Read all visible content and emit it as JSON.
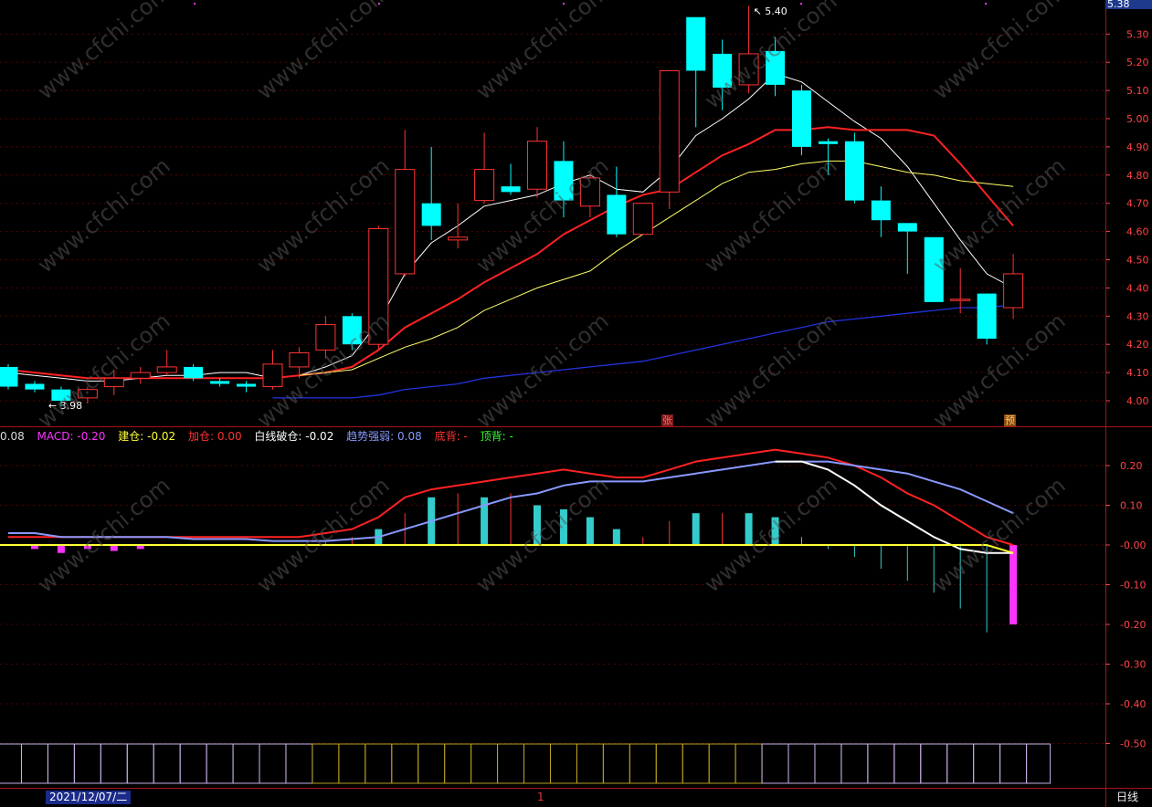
{
  "price_axis_badge": "5.38",
  "period_label": "日线",
  "date_label": "2021/12/07/二",
  "cursor_index_label": "1",
  "tags": [
    {
      "text": "张",
      "bg": "#7a1a1a",
      "fg": "#ff6666"
    },
    {
      "text": "预",
      "bg": "#8a4a10",
      "fg": "#ffcc66"
    }
  ],
  "indicator_header": [
    {
      "key": "prefix",
      "text": "0.08",
      "color": "#dddddd"
    },
    {
      "key": "macd",
      "text": "MACD: -0.20",
      "color": "#ff33ff"
    },
    {
      "key": "jiancang",
      "text": "建仓: -0.02",
      "color": "#ffff33"
    },
    {
      "key": "jiacang",
      "text": "加仓: 0.00",
      "color": "#ff3333"
    },
    {
      "key": "baixian",
      "text": "白线破仓: -0.02",
      "color": "#ffffff"
    },
    {
      "key": "qushi",
      "text": "趋势强弱: 0.08",
      "color": "#8899ff"
    },
    {
      "key": "dibei",
      "text": "底背: -",
      "color": "#ff3333"
    },
    {
      "key": "dingbei",
      "text": "顶背: -",
      "color": "#33ff33"
    }
  ],
  "colors": {
    "up": "#ff3333",
    "down": "#00ffff",
    "ma_white": "#ffffff",
    "ma_red": "#ff2222",
    "ma_yellow": "#ffff66",
    "ma_blue": "#2233dd",
    "grid": "#5a0000",
    "axis_text": "#ff4444",
    "macd_down": "#ff33ff"
  },
  "chart_data": [
    {
      "type": "candlestick",
      "title": "",
      "ylim": [
        3.95,
        5.4
      ],
      "price_ticks": [
        5.3,
        5.2,
        5.1,
        5.0,
        4.9,
        4.8,
        4.7,
        4.6,
        4.5,
        4.4,
        4.3,
        4.2,
        4.1,
        4.0
      ],
      "price_tick_labels": [
        "5.30",
        "5.20",
        "5.10",
        "5.00",
        "4.90",
        "4.80",
        "4.70",
        "4.60",
        "4.50",
        "4.40",
        "4.30",
        "4.20",
        "4.10",
        "4.00"
      ],
      "annotations": [
        {
          "text": "5.40",
          "index": 28
        },
        {
          "text": "3.98",
          "index": 2
        }
      ],
      "candles": [
        {
          "o": 4.12,
          "h": 4.13,
          "l": 4.04,
          "c": 4.05
        },
        {
          "o": 4.06,
          "h": 4.07,
          "l": 4.03,
          "c": 4.04
        },
        {
          "o": 4.04,
          "h": 4.05,
          "l": 3.98,
          "c": 4.0
        },
        {
          "o": 4.01,
          "h": 4.05,
          "l": 3.99,
          "c": 4.04
        },
        {
          "o": 4.05,
          "h": 4.11,
          "l": 4.02,
          "c": 4.08
        },
        {
          "o": 4.08,
          "h": 4.12,
          "l": 4.06,
          "c": 4.1
        },
        {
          "o": 4.1,
          "h": 4.18,
          "l": 4.09,
          "c": 4.12
        },
        {
          "o": 4.12,
          "h": 4.13,
          "l": 4.07,
          "c": 4.08
        },
        {
          "o": 4.07,
          "h": 4.08,
          "l": 4.05,
          "c": 4.06
        },
        {
          "o": 4.06,
          "h": 4.07,
          "l": 4.03,
          "c": 4.05
        },
        {
          "o": 4.05,
          "h": 4.18,
          "l": 4.04,
          "c": 4.13
        },
        {
          "o": 4.12,
          "h": 4.19,
          "l": 4.08,
          "c": 4.17
        },
        {
          "o": 4.18,
          "h": 4.3,
          "l": 4.15,
          "c": 4.27
        },
        {
          "o": 4.3,
          "h": 4.31,
          "l": 4.18,
          "c": 4.2
        },
        {
          "o": 4.2,
          "h": 4.62,
          "l": 4.18,
          "c": 4.61
        },
        {
          "o": 4.45,
          "h": 4.96,
          "l": 4.44,
          "c": 4.82
        },
        {
          "o": 4.7,
          "h": 4.9,
          "l": 4.57,
          "c": 4.62
        },
        {
          "o": 4.57,
          "h": 4.7,
          "l": 4.54,
          "c": 4.58
        },
        {
          "o": 4.71,
          "h": 4.95,
          "l": 4.7,
          "c": 4.82
        },
        {
          "o": 4.76,
          "h": 4.84,
          "l": 4.73,
          "c": 4.74
        },
        {
          "o": 4.75,
          "h": 4.97,
          "l": 4.72,
          "c": 4.92
        },
        {
          "o": 4.85,
          "h": 4.92,
          "l": 4.65,
          "c": 4.71
        },
        {
          "o": 4.69,
          "h": 4.8,
          "l": 4.65,
          "c": 4.79
        },
        {
          "o": 4.73,
          "h": 4.83,
          "l": 4.58,
          "c": 4.59
        },
        {
          "o": 4.59,
          "h": 4.7,
          "l": 4.59,
          "c": 4.7
        },
        {
          "o": 4.74,
          "h": 5.17,
          "l": 4.68,
          "c": 5.17
        },
        {
          "o": 5.36,
          "h": 5.36,
          "l": 4.97,
          "c": 5.17
        },
        {
          "o": 5.23,
          "h": 5.28,
          "l": 5.03,
          "c": 5.11
        },
        {
          "o": 5.12,
          "h": 5.4,
          "l": 5.09,
          "c": 5.23
        },
        {
          "o": 5.24,
          "h": 5.29,
          "l": 5.08,
          "c": 5.12
        },
        {
          "o": 5.1,
          "h": 5.12,
          "l": 4.87,
          "c": 4.9
        },
        {
          "o": 4.92,
          "h": 4.93,
          "l": 4.8,
          "c": 4.91
        },
        {
          "o": 4.92,
          "h": 4.95,
          "l": 4.7,
          "c": 4.71
        },
        {
          "o": 4.71,
          "h": 4.76,
          "l": 4.58,
          "c": 4.64
        },
        {
          "o": 4.63,
          "h": 4.63,
          "l": 4.45,
          "c": 4.6
        },
        {
          "o": 4.58,
          "h": 4.58,
          "l": 4.35,
          "c": 4.35
        },
        {
          "o": 4.36,
          "h": 4.47,
          "l": 4.31,
          "c": 4.36
        },
        {
          "o": 4.38,
          "h": 4.38,
          "l": 4.2,
          "c": 4.22
        },
        {
          "o": 4.33,
          "h": 4.52,
          "l": 4.29,
          "c": 4.45
        }
      ],
      "moving_averages": {
        "white": [
          4.1,
          4.09,
          4.08,
          4.07,
          4.07,
          4.08,
          4.09,
          4.09,
          4.1,
          4.1,
          4.08,
          4.09,
          4.12,
          4.16,
          4.28,
          4.45,
          4.56,
          4.62,
          4.69,
          4.71,
          4.73,
          4.77,
          4.8,
          4.75,
          4.74,
          4.82,
          4.94,
          5.0,
          5.07,
          5.16,
          5.13,
          5.06,
          4.99,
          4.93,
          4.83,
          4.7,
          4.57,
          4.45,
          4.4
        ],
        "red": [
          4.11,
          4.1,
          4.09,
          4.08,
          4.08,
          4.08,
          4.08,
          4.08,
          4.08,
          4.08,
          4.08,
          4.09,
          4.1,
          4.12,
          4.18,
          4.26,
          4.31,
          4.36,
          4.42,
          4.47,
          4.52,
          4.59,
          4.64,
          4.69,
          4.73,
          4.75,
          4.81,
          4.87,
          4.91,
          4.96,
          4.96,
          4.97,
          4.96,
          4.96,
          4.96,
          4.94,
          4.84,
          4.73,
          4.62
        ],
        "yellow": [
          null,
          null,
          null,
          null,
          null,
          null,
          null,
          null,
          null,
          null,
          null,
          4.09,
          4.1,
          4.11,
          4.15,
          4.19,
          4.22,
          4.26,
          4.32,
          4.36,
          4.4,
          4.43,
          4.46,
          4.53,
          4.59,
          4.65,
          4.71,
          4.77,
          4.81,
          4.82,
          4.84,
          4.85,
          4.85,
          4.83,
          4.81,
          4.8,
          4.78,
          4.77,
          4.76
        ],
        "blue": [
          null,
          null,
          null,
          null,
          null,
          null,
          null,
          null,
          null,
          null,
          4.01,
          4.01,
          4.01,
          4.01,
          4.02,
          4.04,
          4.05,
          4.06,
          4.08,
          4.09,
          4.1,
          4.11,
          4.12,
          4.13,
          4.14,
          4.16,
          4.18,
          4.2,
          4.22,
          4.24,
          4.26,
          4.28,
          4.29,
          4.3,
          4.31,
          4.32,
          4.33,
          4.33,
          4.34
        ]
      }
    },
    {
      "type": "bar",
      "title": "",
      "ylim": [
        -0.52,
        0.28
      ],
      "y_ticks": [
        0.2,
        0.1,
        -0.0,
        -0.1,
        -0.2,
        -0.3,
        -0.4,
        -0.5
      ],
      "y_tick_labels": [
        "0.20",
        "0.10",
        "-0.00",
        "-0.10",
        "-0.20",
        "-0.30",
        "-0.40",
        "-0.50"
      ],
      "macd_bars": [
        0.0,
        -0.01,
        -0.02,
        -0.01,
        -0.015,
        -0.01,
        0.0,
        0.0,
        0.0,
        0.0,
        0.0,
        0.0,
        0.01,
        0.02,
        0.04,
        0.08,
        0.12,
        0.13,
        0.12,
        0.13,
        0.1,
        0.09,
        0.07,
        0.04,
        0.02,
        0.06,
        0.08,
        0.08,
        0.08,
        0.07,
        0.02,
        -0.01,
        -0.03,
        -0.06,
        -0.09,
        -0.12,
        -0.16,
        -0.22,
        -0.2
      ],
      "series": [
        {
          "name": "加仓",
          "values": [
            0.02,
            0.02,
            0.02,
            0.02,
            0.02,
            0.02,
            0.02,
            0.02,
            0.02,
            0.02,
            0.02,
            0.02,
            0.03,
            0.04,
            0.07,
            0.12,
            0.14,
            0.15,
            0.16,
            0.17,
            0.18,
            0.19,
            0.18,
            0.17,
            0.17,
            0.19,
            0.21,
            0.22,
            0.23,
            0.24,
            0.23,
            0.22,
            0.2,
            0.17,
            0.13,
            0.1,
            0.06,
            0.02,
            0.0
          ]
        },
        {
          "name": "趋势强弱",
          "values": [
            0.03,
            0.03,
            0.02,
            0.02,
            0.02,
            0.02,
            0.02,
            0.015,
            0.015,
            0.015,
            0.01,
            0.01,
            0.01,
            0.015,
            0.02,
            0.04,
            0.06,
            0.08,
            0.1,
            0.12,
            0.13,
            0.15,
            0.16,
            0.16,
            0.16,
            0.17,
            0.18,
            0.19,
            0.2,
            0.21,
            0.21,
            0.21,
            0.2,
            0.19,
            0.18,
            0.16,
            0.14,
            0.11,
            0.08
          ]
        },
        {
          "name": "白线破仓",
          "values": [
            null,
            null,
            null,
            null,
            null,
            null,
            null,
            null,
            null,
            null,
            null,
            null,
            null,
            null,
            null,
            null,
            null,
            null,
            null,
            null,
            null,
            null,
            null,
            null,
            null,
            null,
            null,
            null,
            null,
            0.21,
            0.21,
            0.19,
            0.15,
            0.1,
            0.06,
            0.02,
            -0.01,
            -0.02,
            -0.02
          ]
        },
        {
          "name": "建仓",
          "values": [
            0.0,
            0.0,
            0.0,
            0.0,
            0.0,
            0.0,
            0.0,
            0.0,
            0.0,
            0.0,
            0.0,
            0.0,
            0.0,
            0.0,
            0.0,
            0.0,
            0.0,
            0.0,
            0.0,
            0.0,
            0.0,
            0.0,
            0.0,
            0.0,
            0.0,
            0.0,
            0.0,
            0.0,
            0.0,
            0.0,
            0.0,
            0.0,
            0.0,
            0.0,
            0.0,
            0.0,
            0.0,
            0.0,
            -0.02
          ]
        }
      ]
    }
  ]
}
